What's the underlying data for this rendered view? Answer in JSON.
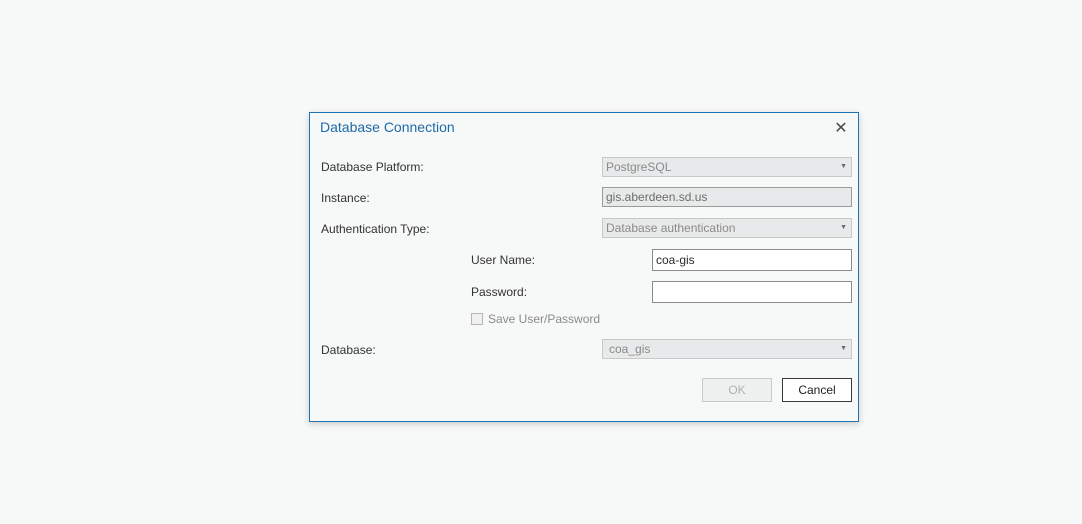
{
  "dialog": {
    "title": "Database Connection",
    "close_icon": "close-icon"
  },
  "fields": {
    "platform_label": "Database Platform:",
    "platform_value": "PostgreSQL",
    "instance_label": "Instance:",
    "instance_value": "gis.aberdeen.sd.us",
    "auth_label": "Authentication Type:",
    "auth_value": "Database authentication",
    "username_label": "User Name:",
    "username_value": "coa-gis",
    "password_label": "Password:",
    "password_value": "",
    "save_label": "Save User/Password",
    "database_label": "Database:",
    "database_value": "coa_gis"
  },
  "buttons": {
    "ok": "OK",
    "cancel": "Cancel"
  }
}
